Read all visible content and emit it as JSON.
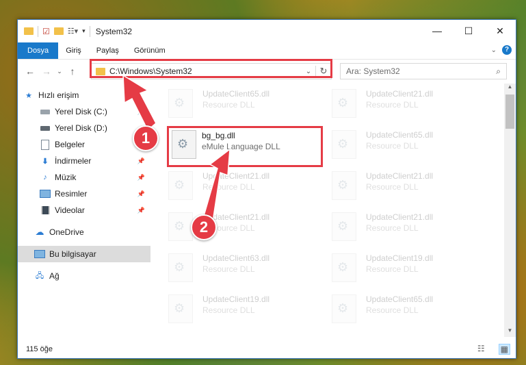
{
  "window": {
    "title": "System32"
  },
  "ribbon": {
    "tabs": [
      "Dosya",
      "Giriş",
      "Paylaş",
      "Görünüm"
    ]
  },
  "address": {
    "path": "C:\\Windows\\System32"
  },
  "search": {
    "placeholder": "Ara: System32"
  },
  "nav": {
    "items": [
      {
        "label": "Hızlı erişim",
        "icon": "star-icon"
      },
      {
        "label": "Yerel Disk (C:)",
        "icon": "drive-icon"
      },
      {
        "label": "Yerel Disk (D:)",
        "icon": "drive-icon"
      },
      {
        "label": "Belgeler",
        "icon": "documents-icon"
      },
      {
        "label": "İndirmeler",
        "icon": "download-icon"
      },
      {
        "label": "Müzik",
        "icon": "music-icon"
      },
      {
        "label": "Resimler",
        "icon": "pictures-icon"
      },
      {
        "label": "Videolar",
        "icon": "video-icon"
      },
      {
        "label": "OneDrive",
        "icon": "cloud-icon"
      },
      {
        "label": "Bu bilgisayar",
        "icon": "computer-icon"
      },
      {
        "label": "Ağ",
        "icon": "network-icon"
      }
    ]
  },
  "files": [
    {
      "name": "UpdateClient65.dll",
      "desc": "Resource DLL"
    },
    {
      "name": "UpdateClient21.dll",
      "desc": "Resource DLL"
    },
    {
      "name": "UpdateClient65.dll",
      "desc": "Resource DLL"
    },
    {
      "name": "UpdateClient21.dll",
      "desc": "Resource DLL"
    },
    {
      "name": "UpdateClient21.dll",
      "desc": "Resource DLL"
    },
    {
      "name": "UpdateClient21.dll",
      "desc": "Resource DLL"
    },
    {
      "name": "UpdateClient21.dll",
      "desc": "Resource DLL"
    },
    {
      "name": "UpdateClient63.dll",
      "desc": "Resource DLL"
    },
    {
      "name": "UpdateClient19.dll",
      "desc": "Resource DLL"
    },
    {
      "name": "UpdateClient19.dll",
      "desc": "Resource DLL"
    },
    {
      "name": "UpdateClient65.dll",
      "desc": "Resource DLL"
    }
  ],
  "highlight_file": {
    "name": "bg_bg.dll",
    "desc": "eMule Language DLL"
  },
  "status": {
    "count": "115 öğe"
  },
  "badges": {
    "one": "1",
    "two": "2"
  },
  "colors": {
    "accent": "#1979ca",
    "annotation": "#e53b45"
  }
}
